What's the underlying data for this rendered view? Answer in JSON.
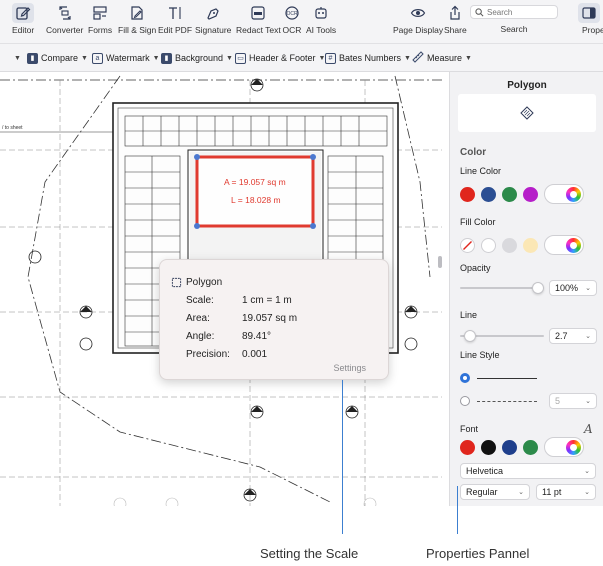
{
  "toolbar": {
    "tools": [
      {
        "name": "editor",
        "label": "Editor",
        "active": true
      },
      {
        "name": "converter",
        "label": "Converter"
      },
      {
        "name": "forms",
        "label": "Forms"
      },
      {
        "name": "fill-sign",
        "label": "Fill & Sign"
      },
      {
        "name": "edit-pdf",
        "label": "Edit PDF"
      },
      {
        "name": "signature",
        "label": "Signature"
      },
      {
        "name": "redact-text",
        "label": "Redact Text"
      },
      {
        "name": "ocr",
        "label": "OCR"
      },
      {
        "name": "ai-tools",
        "label": "AI Tools"
      },
      {
        "name": "page-display",
        "label": "Page Display"
      },
      {
        "name": "share",
        "label": "Share"
      }
    ],
    "search_placeholder": "Search",
    "search_label": "Search",
    "properties_label": "Properties"
  },
  "subtoolbar": {
    "compare": "Compare",
    "watermark": "Watermark",
    "background": "Background",
    "header_footer": "Header & Footer",
    "bates_numbers": "Bates Numbers",
    "measure": "Measure"
  },
  "canvas": {
    "area_label": "A = 19.057 sq m",
    "length_label": "L = 18.028 m",
    "side_note": "/ to sheet",
    "accent_color": "#e03a2f"
  },
  "popup": {
    "title": "Polygon",
    "rows": [
      {
        "label": "Scale:",
        "value": "1 cm = 1 m"
      },
      {
        "label": "Area:",
        "value": "19.057 sq m"
      },
      {
        "label": "Angle:",
        "value": "89.41°"
      },
      {
        "label": "Precision:",
        "value": "0.001"
      }
    ],
    "settings": "Settings"
  },
  "panel": {
    "title": "Polygon",
    "color_heading": "Color",
    "line_color": "Line Color",
    "line_colors": [
      "#e0261d",
      "#2c4f93",
      "#2c8a4a",
      "#b61ec9",
      "#ffffff"
    ],
    "fill_color": "Fill Color",
    "fill_colors": [
      "#ffffff",
      "#d9d9dd",
      "#fbe7b5"
    ],
    "opacity_label": "Opacity",
    "opacity_value": "100%",
    "opacity_fraction": 1.0,
    "line_label": "Line",
    "line_value": "2.7",
    "line_fraction": 0.05,
    "line_style_label": "Line Style",
    "dash_value": "5",
    "font_label": "Font",
    "font_colors": [
      "#e0261d",
      "#111111",
      "#1f3f8c",
      "#2c8a4a",
      "#ffffff"
    ],
    "font_family": "Helvetica",
    "font_style": "Regular",
    "font_size": "11 pt"
  },
  "annotations": {
    "scale_label": "Setting the Scale",
    "panel_label": "Properties Pannel"
  }
}
